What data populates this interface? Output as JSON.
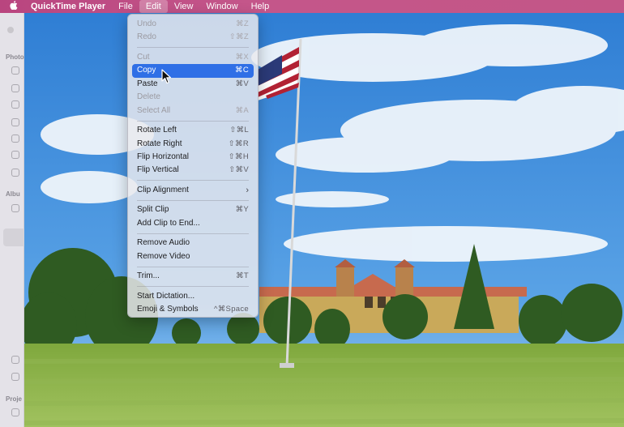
{
  "menubar": {
    "apple": "",
    "app_name": "QuickTime Player",
    "items": [
      "File",
      "Edit",
      "View",
      "Window",
      "Help"
    ],
    "active_item": "Edit"
  },
  "background_app": {
    "labels": [
      "Photo",
      "Albu",
      "Proje"
    ]
  },
  "edit_menu": {
    "undo": {
      "label": "Undo",
      "shortcut": "⌘Z"
    },
    "redo": {
      "label": "Redo",
      "shortcut": "⇧⌘Z"
    },
    "cut": {
      "label": "Cut",
      "shortcut": "⌘X"
    },
    "copy": {
      "label": "Copy",
      "shortcut": "⌘C"
    },
    "paste": {
      "label": "Paste",
      "shortcut": "⌘V"
    },
    "delete": {
      "label": "Delete",
      "shortcut": ""
    },
    "select_all": {
      "label": "Select All",
      "shortcut": "⌘A"
    },
    "rotate_left": {
      "label": "Rotate Left",
      "shortcut": "⇧⌘L"
    },
    "rotate_right": {
      "label": "Rotate Right",
      "shortcut": "⇧⌘R"
    },
    "flip_horizontal": {
      "label": "Flip Horizontal",
      "shortcut": "⇧⌘H"
    },
    "flip_vertical": {
      "label": "Flip Vertical",
      "shortcut": "⇧⌘V"
    },
    "clip_alignment": {
      "label": "Clip Alignment",
      "shortcut": "›"
    },
    "split_clip": {
      "label": "Split Clip",
      "shortcut": "⌘Y"
    },
    "add_clip": {
      "label": "Add Clip to End...",
      "shortcut": ""
    },
    "remove_audio": {
      "label": "Remove Audio",
      "shortcut": ""
    },
    "remove_video": {
      "label": "Remove Video",
      "shortcut": ""
    },
    "trim": {
      "label": "Trim...",
      "shortcut": "⌘T"
    },
    "dictation": {
      "label": "Start Dictation...",
      "shortcut": ""
    },
    "emoji": {
      "label": "Emoji & Symbols",
      "shortcut": "^⌘Space"
    }
  },
  "colors": {
    "menubar": "#c04e85",
    "highlight": "#2f6fe6",
    "sky": "#3f8fd8",
    "grass": "#8fb552"
  }
}
